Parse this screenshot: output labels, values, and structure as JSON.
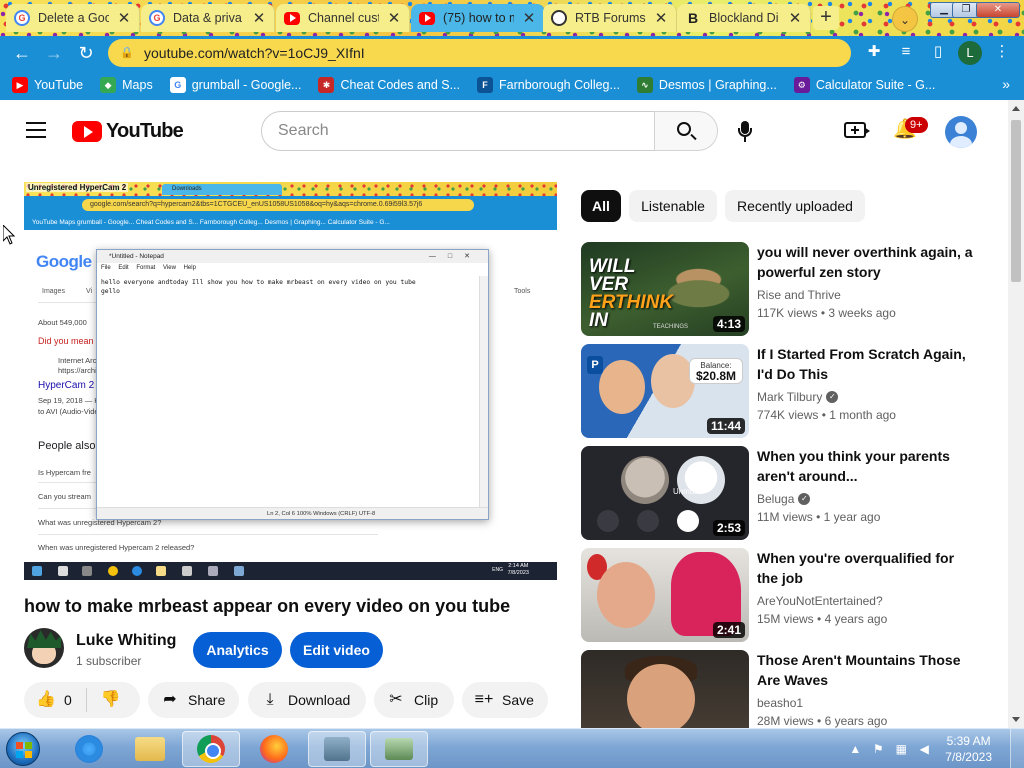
{
  "browser": {
    "tabs": [
      {
        "title": "Delete a Goo",
        "favicon": "google-icon",
        "active": false
      },
      {
        "title": "Data & priva",
        "favicon": "google-icon",
        "active": false
      },
      {
        "title": "Channel cust",
        "favicon": "youtube-icon",
        "active": false
      },
      {
        "title": "(75) how to m",
        "favicon": "youtube-icon",
        "active": true
      },
      {
        "title": "RTB Forums",
        "favicon": "rtb-icon",
        "active": false
      },
      {
        "title": "Blockland Di",
        "favicon": "blockland-icon",
        "active": false
      }
    ],
    "new_tab": "+",
    "url": "youtube.com/watch?v=1oCJ9_XIfnI",
    "profile_initial": "L",
    "bookmarks": [
      {
        "label": "YouTube",
        "color": "#ff0000"
      },
      {
        "label": "Maps",
        "color": "#34a853"
      },
      {
        "label": "grumball - Google...",
        "color": "#4285f4"
      },
      {
        "label": "Cheat Codes and S...",
        "color": "#c62828"
      },
      {
        "label": "Farnborough Colleg...",
        "color": "#0b5394"
      },
      {
        "label": "Desmos | Graphing...",
        "color": "#2e7d32"
      },
      {
        "label": "Calculator Suite - G...",
        "color": "#6a1b9a"
      }
    ],
    "bookmarks_overflow": "»"
  },
  "youtube": {
    "logo_text": "YouTube",
    "search_placeholder": "Search",
    "notification_badge": "9+",
    "filter_chips": [
      {
        "label": "All",
        "active": true
      },
      {
        "label": "Listenable",
        "active": false
      },
      {
        "label": "Recently uploaded",
        "active": false
      }
    ]
  },
  "video": {
    "title": "how to make mrbeast appear on every video on you tube",
    "channel_name": "Luke Whiting",
    "subscribers": "1 subscriber",
    "analytics_label": "Analytics",
    "edit_label": "Edit video",
    "like_count": "0",
    "share_label": "Share",
    "download_label": "Download",
    "clip_label": "Clip",
    "save_label": "Save"
  },
  "recording": {
    "overlay_title": "Unregistered HyperCam 2",
    "inner_tabs": "Downloads",
    "inner_url": "google.com/search?q=hypercam2&tbs=1CTGCEU_enUS1058US1058&oq=hy&aqs=chrome.0.69i59l3.57j6",
    "inner_bookmarks": "YouTube   Maps   grumball - Google...   Cheat Codes and S...   Farnborough Colleg...   Desmos | Graphing...   Calculator Suite - G...",
    "google_logo": "Google",
    "google_tabs": [
      "Images",
      "Vi",
      "Tools"
    ],
    "results_count": "About 549,000",
    "did_you_mean": "Did you mean",
    "result_site": "Internet Arc",
    "result_url": "https://archive",
    "result_title": "HyperCam 2",
    "result_date": "Sep 19, 2018 — H",
    "result_snip": "to AVI (Audio-Vide",
    "people_also": "People also",
    "faq": [
      "Is Hypercam fre",
      "Can you stream",
      "What was unregistered Hypercam 2?",
      "When was unregistered Hypercam 2 released?"
    ],
    "notepad_title": "*Untitled - Notepad",
    "notepad_menu": "File Edit Format View Help",
    "notepad_text": "hello everyone andtoday Ill show you how to make mrbeast on every video on you tube\ngello",
    "notepad_status": "Ln 2, Col 6        100%     Windows (CRLF)      UTF-8",
    "clock_time": "2:14 AM",
    "clock_date": "7/8/2023",
    "tray_lang": "ENG"
  },
  "recommendations": [
    {
      "title": "you will never overthink again, a powerful zen story",
      "channel": "Rise and Thrive",
      "verified": false,
      "views": "117K views",
      "age": "3 weeks ago",
      "duration": "4:13",
      "thumb_text_1": "WILL",
      "thumb_text_2": "VER",
      "thumb_text_3": "ERTHINK",
      "thumb_text_4": "IN",
      "thumb_footer": "TEACHINGS"
    },
    {
      "title": "If I Started From Scratch Again, I'd Do This",
      "channel": "Mark Tilbury",
      "verified": true,
      "views": "774K views",
      "age": "1 month ago",
      "duration": "11:44",
      "thumb_label": "Balance:",
      "thumb_amount": "$20.8M"
    },
    {
      "title": "When you think your parents aren't around...",
      "channel": "Beluga",
      "verified": true,
      "views": "11M views",
      "age": "1 year ago",
      "duration": "2:53",
      "thumb_text": "Unmute"
    },
    {
      "title": "When you're overqualified for the job",
      "channel": "AreYouNotEntertained?",
      "verified": false,
      "views": "15M views",
      "age": "4 years ago",
      "duration": "2:41"
    },
    {
      "title": "Those Aren't Mountains Those Are Waves",
      "channel": "beasho1",
      "verified": false,
      "views": "28M views",
      "age": "6 years ago",
      "duration": ""
    }
  ],
  "taskbar": {
    "time": "5:39 AM",
    "date": "7/8/2023"
  }
}
